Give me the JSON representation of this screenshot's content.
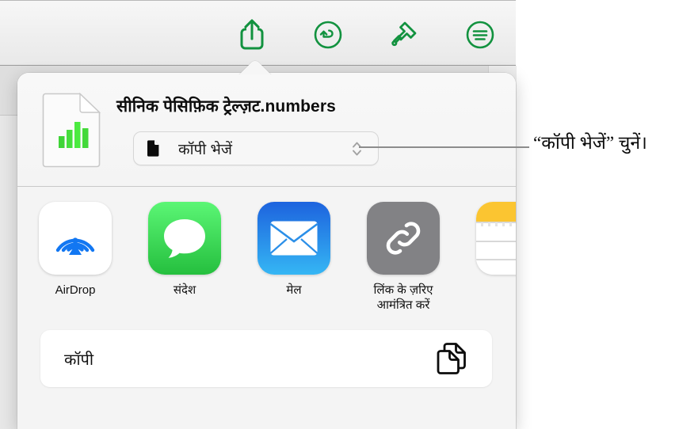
{
  "toolbar": {
    "buttons": [
      {
        "name": "share-button",
        "icon": "share-icon",
        "label": "Share"
      },
      {
        "name": "undo-button",
        "icon": "undo-icon",
        "label": "Undo"
      },
      {
        "name": "format-button",
        "icon": "paintbrush-icon",
        "label": "Format"
      },
      {
        "name": "more-button",
        "icon": "more-options-icon",
        "label": "More"
      }
    ],
    "accent_color": "#12923f"
  },
  "share_sheet": {
    "document": {
      "title": "सीनिक पेसिफ़िक ट्रेल्ज़ट.numbers",
      "icon": "numbers-document-icon"
    },
    "option_popup": {
      "label": "कॉपी भेजें",
      "icon": "document-icon",
      "chevron": "chevron-up-down-icon"
    },
    "targets": [
      {
        "name": "airdrop",
        "label": "AirDrop",
        "icon": "airdrop-icon",
        "color": "#ffffff"
      },
      {
        "name": "messages",
        "label": "संदेश",
        "icon": "messages-icon",
        "color": "#35c759"
      },
      {
        "name": "mail",
        "label": "मेल",
        "icon": "mail-icon",
        "color": "#1d7ff0"
      },
      {
        "name": "invite-with-link",
        "label": "लिंक के ज़रिए\nआमंत्रित करें",
        "icon": "link-icon",
        "color": "#828285"
      },
      {
        "name": "notes",
        "label": "",
        "icon": "notes-icon",
        "color": "#fbc531"
      }
    ],
    "actions": [
      {
        "name": "copy",
        "label": "कॉपी",
        "icon": "copy-icon"
      }
    ]
  },
  "callout": {
    "text": "“कॉपी भेजें” चुनें।"
  }
}
